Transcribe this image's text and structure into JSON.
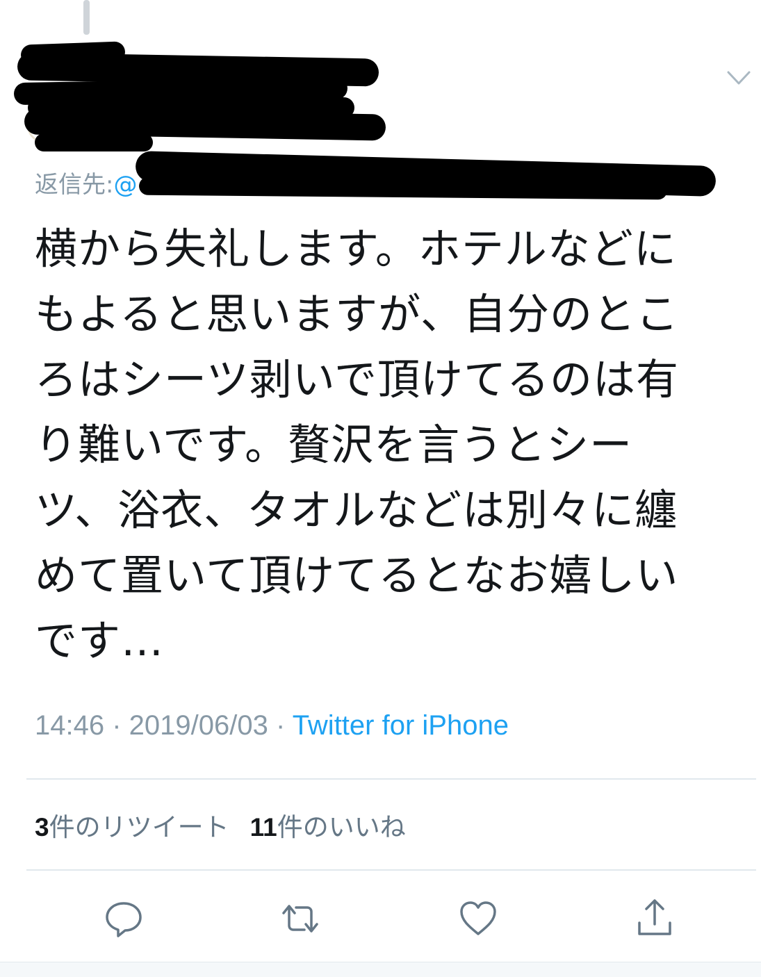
{
  "tweet": {
    "reply_label": "返信先:",
    "reply_handle": "@",
    "text_lines": [
      "横から失礼します。ホテルなどに",
      "もよると思いますが、自分のとこ",
      "ろはシーツ剥いで頂けてるのは有",
      "り難いです。贅沢を言うとシー",
      "ツ、浴衣、タオルなどは別々に纏",
      "めて置いて頂けてるとなお嬉しい",
      "です…"
    ],
    "time": "14:46",
    "separator": " · ",
    "date": "2019/06/03",
    "source": "Twitter for iPhone"
  },
  "stats": {
    "retweets_count": "3",
    "retweets_label": "件のリツイート",
    "likes_count": "11",
    "likes_label": "件のいいね"
  },
  "icons": {
    "caret": "chevron-down-icon",
    "reply": "reply-icon",
    "retweet": "retweet-icon",
    "like": "heart-icon",
    "share": "share-icon"
  },
  "colors": {
    "link": "#1da1f2",
    "muted": "#8899a6",
    "text": "#14171a",
    "icon": "#657786"
  }
}
